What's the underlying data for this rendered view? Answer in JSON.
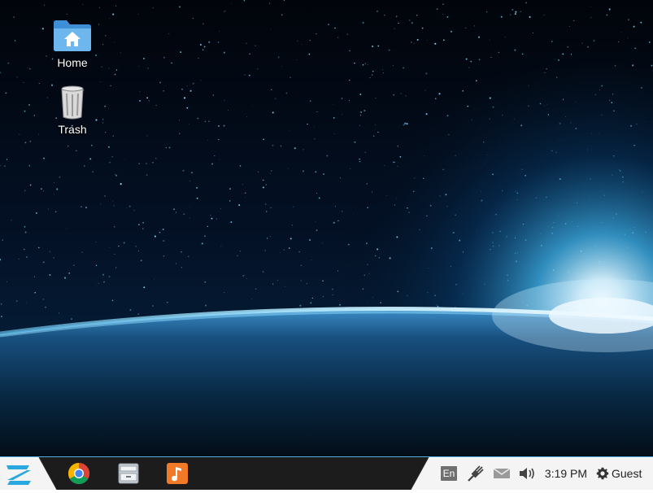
{
  "desktop": {
    "icons": [
      {
        "label": "Home",
        "icon": "home-folder-icon"
      },
      {
        "label": "Trash",
        "icon": "trash-icon"
      }
    ]
  },
  "taskbar": {
    "start_icon": "zorin-logo-icon",
    "launchers": [
      {
        "icon": "chrome-icon"
      },
      {
        "icon": "file-manager-icon"
      },
      {
        "icon": "music-player-icon"
      }
    ],
    "tray": {
      "language": "En",
      "network_icon": "network-wired-icon",
      "mail_icon": "mail-icon",
      "volume_icon": "volume-icon",
      "clock": "3:19 PM",
      "user": "Guest",
      "user_icon": "gear-icon"
    }
  },
  "colors": {
    "taskbar_dark": "#1b1b1b",
    "taskbar_light": "#f4f4f4",
    "accent": "#29a8e0"
  }
}
